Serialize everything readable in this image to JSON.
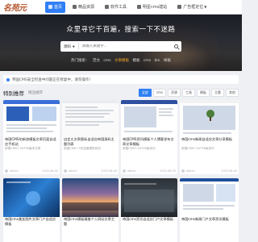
{
  "nav": {
    "logo": "名苑元",
    "items": [
      {
        "label": "首页",
        "active": true,
        "icon": "home-icon"
      },
      {
        "label": "精品资源",
        "active": false,
        "icon": "star-icon"
      },
      {
        "label": "软件工具",
        "active": false,
        "icon": "box-icon"
      },
      {
        "label": "明星cms建站",
        "active": false,
        "icon": "globe-icon"
      },
      {
        "label": "广告框定位",
        "active": false,
        "icon": "book-icon",
        "caret": true
      }
    ]
  },
  "hero": {
    "title": "众里寻它千百遍，搜索一下不迷路",
    "search_select": "源码",
    "search_placeholder": "请输入关键字...",
    "hot_label": "热门搜索：",
    "hot_items": [
      {
        "label": "范文",
        "highlight": false
      },
      {
        "label": "cms",
        "highlight": false
      },
      {
        "label": "文章模板",
        "highlight": true
      },
      {
        "label": "模板",
        "highlight": false
      },
      {
        "label": "cms",
        "highlight": false
      },
      {
        "label": "bin",
        "highlight": false
      },
      {
        "label": "样板",
        "highlight": false
      }
    ]
  },
  "notice": {
    "text": "帝国CMS安全检查中问题正在修复中，请勿操作！"
  },
  "section": {
    "title": "特别推荐",
    "subtitle": "精品推荐",
    "tabs": [
      {
        "label": "全部",
        "active": true
      },
      {
        "label": "cms",
        "active": false
      },
      {
        "label": "资源",
        "active": false
      },
      {
        "label": "工具",
        "active": false
      },
      {
        "label": "模板",
        "active": false
      },
      {
        "label": "主题",
        "active": false
      },
      {
        "label": "其他",
        "active": false
      }
    ]
  },
  "cards": [
    {
      "title": "帝国CMS仿新浪模板文章页面自适应手机站",
      "desc": "帝国CMS7.5UTF8版本文章",
      "author": "admin",
      "date": "2022-06-05",
      "thumb": "mock-blue"
    },
    {
      "title": "自定义文章图标自适应帝国源码主题列表",
      "desc": "帝国CMS7.5内容管理系统仿",
      "author": "admin",
      "date": "2022-06-05",
      "thumb": "mock-white"
    },
    {
      "title": "帝国CMS资讯模板个人博客发布文章文章模板",
      "desc": "帝国CMS7.5UTF8版本仿",
      "author": "admin",
      "date": "2022-06-05",
      "thumb": "mock-photo"
    },
    {
      "title": "帝国cms新闻自适应文章分享模板",
      "desc": "帝国CMS7.5UTF8版本仿",
      "author": "admin",
      "date": "2022-06-05",
      "thumb": "mock-tree"
    },
    {
      "title": "帝国cms美女图片文章门户自适应模板",
      "desc": "帝国CMS7.5UTF8版本仿",
      "author": "admin",
      "date": "2022-06-05",
      "thumb": "photo-blue"
    },
    {
      "title": "帝国cms模板精美个人网站文章主题",
      "desc": "帝国CMS7.5UTF8版本仿",
      "author": "admin",
      "date": "2022-06-05",
      "thumb": "photo-sunset"
    },
    {
      "title": "帝国cms资讯自适应门户文章模板",
      "desc": "帝国CMS7.5UTF8版本仿",
      "author": "admin",
      "date": "2022-06-05",
      "thumb": "photo-dark"
    },
    {
      "title": "帝国cms新闻门户文章资讯模板",
      "desc": "帝国CMS7.5UTF8版本仿",
      "author": "admin",
      "date": "2022-06-05",
      "thumb": "mock-portal"
    }
  ]
}
